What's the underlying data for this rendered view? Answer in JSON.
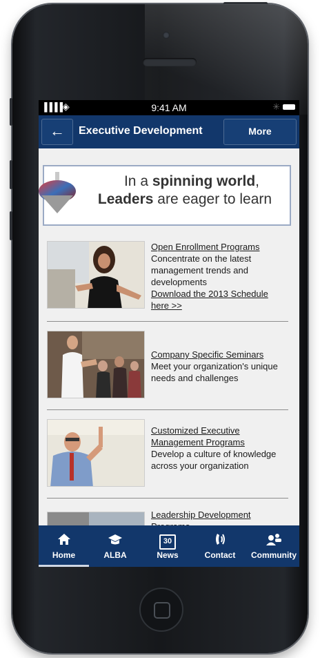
{
  "status_bar": {
    "signal": "▐▐▐▐",
    "time": "9:41 AM",
    "bluetooth": "✳"
  },
  "nav": {
    "back_glyph": "←",
    "title": "Executive Development",
    "more_label": "More"
  },
  "banner": {
    "line1_pre": "In a ",
    "line1_bold": "spinning world",
    "line1_post": ",",
    "line2_bold": "Leaders",
    "line2_post": " are eager to learn"
  },
  "items": [
    {
      "title": "Open Enrollment Programs",
      "desc": "Concentrate on the latest management trends and developments",
      "link": "Download the 2013 Schedule here >>"
    },
    {
      "title": "Company Specific Seminars",
      "desc": "Meet your organization's unique needs and challenges"
    },
    {
      "title": "Customized Executive Management Programs",
      "desc": "Develop a culture of knowledge across your organization"
    },
    {
      "title": "Leadership Development Programs"
    }
  ],
  "tabs": [
    {
      "label": "Home",
      "icon": "home-icon"
    },
    {
      "label": "ALBA",
      "icon": "graduation-cap-icon"
    },
    {
      "label": "News",
      "icon": "calendar-icon",
      "day": "30"
    },
    {
      "label": "Contact",
      "icon": "phone-icon"
    },
    {
      "label": "Community",
      "icon": "people-icon"
    }
  ],
  "colors": {
    "nav": "#12376b",
    "screen_bg": "#f0f0f0",
    "phone_body": "#16181b"
  }
}
